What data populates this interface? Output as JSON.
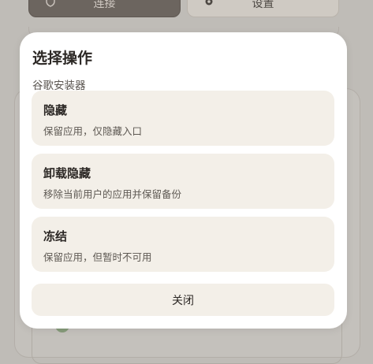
{
  "background": {
    "connect_label": "连接",
    "settings_label": "设置"
  },
  "dialog": {
    "title": "选择操作",
    "subtitle": "谷歌安装器",
    "options": [
      {
        "title": "隐藏",
        "description": "保留应用，仅隐藏入口"
      },
      {
        "title": "卸载隐藏",
        "description": "移除当前用户的应用并保留备份"
      },
      {
        "title": "冻结",
        "description": "保留应用，但暂时不可用"
      }
    ],
    "close_label": "关闭"
  },
  "colors": {
    "dialog_bg": "#ffffff",
    "option_bg": "#f3efe8",
    "scrim": "#bfbcb7",
    "connect_button": "#6c655f"
  }
}
